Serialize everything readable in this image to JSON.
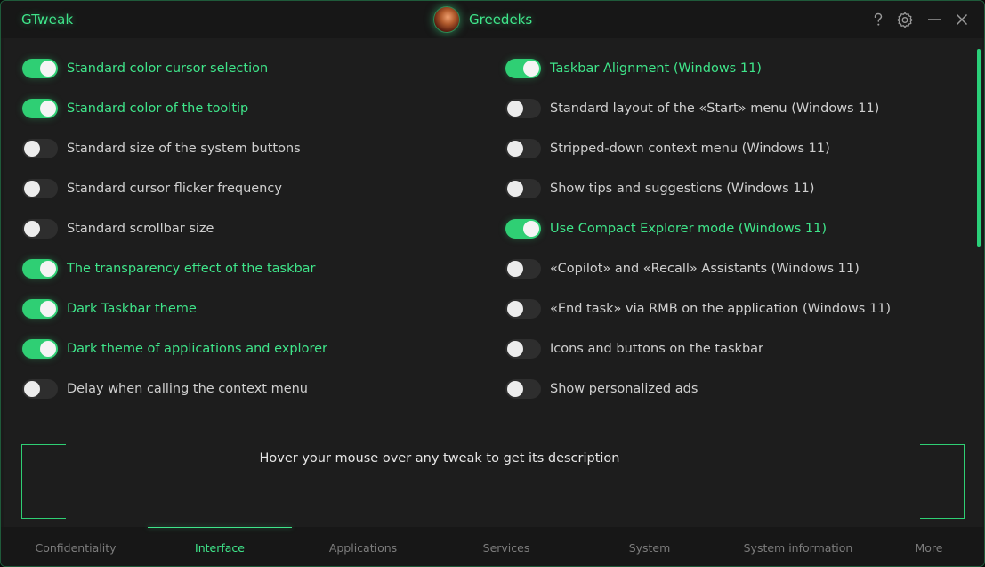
{
  "app": {
    "title": "GTweak",
    "user_name": "Greedeks"
  },
  "colors": {
    "accent": "#3fe58a",
    "toggle_on": "#2fcf74",
    "toggle_off": "#2e2e2e",
    "background": "#1d1d1d"
  },
  "icons": [
    "help-icon",
    "settings-gear-icon",
    "minimize-icon",
    "close-icon"
  ],
  "tweaks_left": [
    {
      "label": "Standard color cursor selection",
      "on": true
    },
    {
      "label": "Standard color of the tooltip",
      "on": true
    },
    {
      "label": "Standard size of the system buttons",
      "on": false
    },
    {
      "label": "Standard cursor flicker frequency",
      "on": false
    },
    {
      "label": "Standard scrollbar size",
      "on": false
    },
    {
      "label": "The transparency effect of the taskbar",
      "on": true
    },
    {
      "label": "Dark Taskbar theme",
      "on": true
    },
    {
      "label": "Dark theme of applications and explorer",
      "on": true
    },
    {
      "label": "Delay when calling the context menu",
      "on": false
    }
  ],
  "tweaks_right": [
    {
      "label": "Taskbar Alignment (Windows 11)",
      "on": true
    },
    {
      "label": "Standard layout of the «Start» menu (Windows 11)",
      "on": false
    },
    {
      "label": "Stripped-down context menu (Windows 11)",
      "on": false
    },
    {
      "label": "Show tips and suggestions (Windows 11)",
      "on": false
    },
    {
      "label": "Use Compact Explorer mode (Windows 11)",
      "on": true
    },
    {
      "label": "«Copilot» and «Recall» Assistants (Windows 11)",
      "on": false
    },
    {
      "label": "«End task» via RMB on the application (Windows 11)",
      "on": false
    },
    {
      "label": "Icons and buttons on the taskbar",
      "on": false
    },
    {
      "label": "Show personalized ads",
      "on": false
    }
  ],
  "description": {
    "text": "Hover your mouse over any tweak to get its description"
  },
  "nav": {
    "items": [
      {
        "label": "Confidentiality",
        "active": false
      },
      {
        "label": "Interface",
        "active": true
      },
      {
        "label": "Applications",
        "active": false
      },
      {
        "label": "Services",
        "active": false
      },
      {
        "label": "System",
        "active": false
      },
      {
        "label": "System information",
        "active": false
      },
      {
        "label": "More",
        "active": false
      }
    ]
  }
}
